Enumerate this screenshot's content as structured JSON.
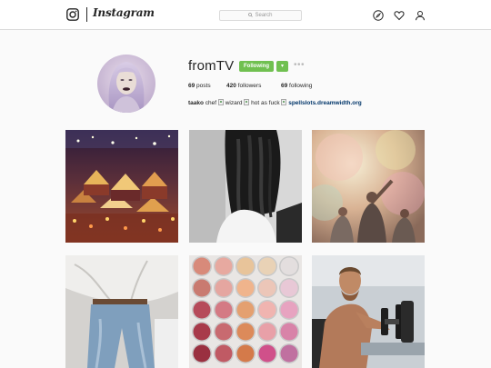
{
  "header": {
    "app_name": "Instagram",
    "search_placeholder": "Search"
  },
  "profile": {
    "username": "fromTV",
    "follow_label": "Following",
    "dropdown_glyph": "▾",
    "more_glyph": "•••",
    "stats": {
      "posts_count": "69",
      "posts_label": "posts",
      "followers_count": "420",
      "followers_label": "followers",
      "following_count": "69",
      "following_label": "following"
    },
    "bio": {
      "name": "taako",
      "word1": "chef",
      "word2": "wizard",
      "word3": "hot as fuck",
      "link": "spellslots.dreamwidth.org"
    }
  },
  "colors": {
    "follow_green": "#70c050",
    "link_blue": "#003569",
    "border": "#dbdbdb"
  },
  "posts": [
    {
      "subject": "night-market"
    },
    {
      "subject": "dreadlocks-black-white"
    },
    {
      "subject": "color-powder-crowd"
    },
    {
      "subject": "denim-fashion"
    },
    {
      "subject": "eyeshadow-palette"
    },
    {
      "subject": "dumbbell-workout"
    }
  ]
}
